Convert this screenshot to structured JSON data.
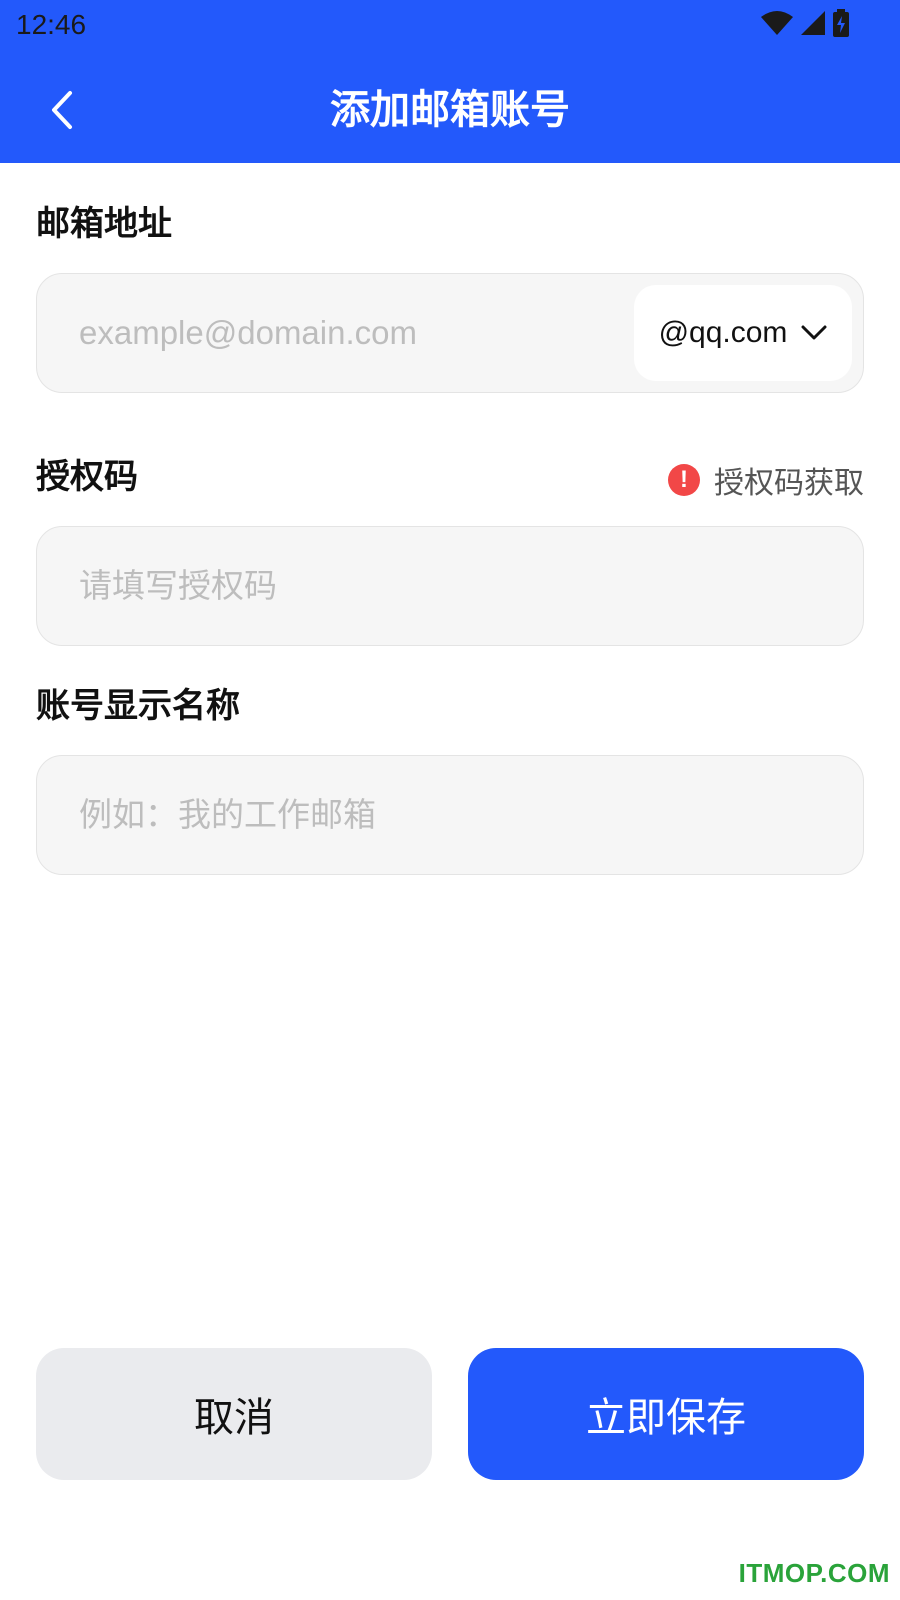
{
  "status_bar": {
    "time": "12:46",
    "icons": [
      "wifi-icon",
      "signal-icon",
      "battery-charging-icon"
    ]
  },
  "header": {
    "title": "添加邮箱账号",
    "back_icon": "chevron-left-icon"
  },
  "email_section": {
    "label": "邮箱地址",
    "input_placeholder": "example@domain.com",
    "input_value": "",
    "domain_selected": "@qq.com",
    "domain_icon": "chevron-down-icon"
  },
  "auth_section": {
    "label": "授权码",
    "help_link": "授权码获取",
    "help_icon": "alert-circle-icon",
    "help_glyph": "!",
    "input_placeholder": "请填写授权码",
    "input_value": ""
  },
  "name_section": {
    "label": "账号显示名称",
    "input_placeholder": "例如：我的工作邮箱",
    "input_value": ""
  },
  "actions": {
    "cancel_label": "取消",
    "save_label": "立即保存"
  },
  "watermark": "ITMOP.COM",
  "colors": {
    "primary": "#2359fb",
    "alert": "#f24747",
    "field_bg": "#f6f6f6",
    "cancel_bg": "#eaebee",
    "watermark": "#2aa33a"
  }
}
